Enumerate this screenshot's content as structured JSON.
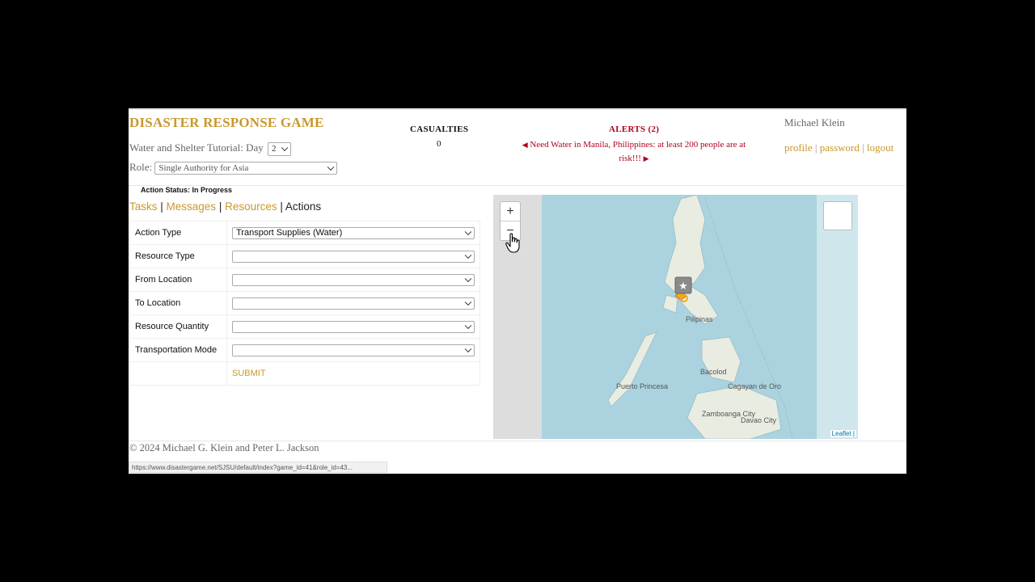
{
  "app": {
    "title": "DISASTER RESPONSE GAME",
    "tutorial_label": "Water and Shelter Tutorial: Day",
    "day_value": "2",
    "role_label": "Role:",
    "role_value": "Single Authority for Asia"
  },
  "casualties": {
    "label": "CASUALTIES",
    "value": "0"
  },
  "alerts": {
    "label": "ALERTS (2)",
    "message": "Need Water in Manila, Philippines: at least 200 people are at risk!!!"
  },
  "user": {
    "name": "Michael Klein",
    "links": [
      "profile",
      "password",
      "logout"
    ],
    "separator": " | "
  },
  "action_status": "Action Status: In Progress",
  "tabs": [
    {
      "label": "Tasks",
      "active": false
    },
    {
      "label": "Messages",
      "active": false
    },
    {
      "label": "Resources",
      "active": false
    },
    {
      "label": "Actions",
      "active": true
    }
  ],
  "form": {
    "rows": [
      {
        "label": "Action Type",
        "value": "Transport Supplies (Water)"
      },
      {
        "label": "Resource Type",
        "value": ""
      },
      {
        "label": "From Location",
        "value": ""
      },
      {
        "label": "To Location",
        "value": ""
      },
      {
        "label": "Resource Quantity",
        "value": ""
      },
      {
        "label": "Transportation Mode",
        "value": ""
      }
    ],
    "submit_label": "SUBMIT"
  },
  "map": {
    "zoom_in": "+",
    "zoom_out": "−",
    "attribution": "Leaflet |",
    "labels": [
      "Pilipinas",
      "Bacolod",
      "Puerto Princesa",
      "Cagayan de Oro",
      "Zamboanga City",
      "Davao City"
    ],
    "water_color": "#aad3df",
    "land_color": "#f2efe9",
    "marker_color": "#f5a623"
  },
  "footer": {
    "copyright": "© 2024 Michael G. Klein and Peter L. Jackson",
    "status_url": "https://www.disastergame.net/SJSU/default/index?game_id=41&role_id=43..."
  }
}
